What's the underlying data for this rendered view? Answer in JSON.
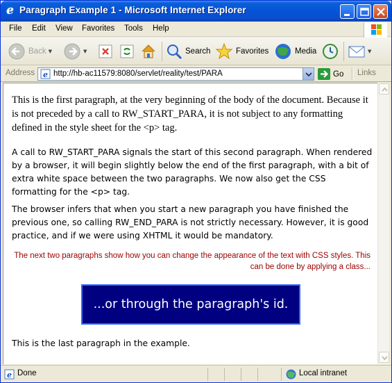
{
  "window": {
    "title": "Paragraph Example 1 - Microsoft Internet Explorer"
  },
  "menu": [
    "File",
    "Edit",
    "View",
    "Favorites",
    "Tools",
    "Help"
  ],
  "toolbar": {
    "back_label": "Back",
    "search_label": "Search",
    "favorites_label": "Favorites",
    "media_label": "Media"
  },
  "address": {
    "label": "Address",
    "url": "http://hb-ac11579:8080/servlet/reality/test/PARA",
    "go_label": "Go",
    "links_label": "Links"
  },
  "content": {
    "para1": "This is the first paragraph, at the very beginning of the body of the document. Because it is not preceded by a call to RW_START_PARA, it is not subject to any formatting defined in the style sheet for the <p> tag.",
    "para2": "A call to RW_START_PARA signals the start of this second paragraph. When rendered by a browser, it will begin slightly below the end of the first paragraph, with a bit of extra white space between the two paragraphs. We now also get the CSS formatting for the <p> tag.",
    "para3": "The browser infers that when you start a new paragraph you have finished the previous one, so calling RW_END_PARA is not strictly necessary. However, it is good practice, and if we were using XHTML it would be mandatory.",
    "para4": "The next two paragraphs show how you can change the appearance of the text with CSS styles. This can be done by applying a class...",
    "para5": "...or through the paragraph's id.",
    "para6": "This is the last paragraph in the example."
  },
  "status": {
    "text": "Done",
    "zone": "Local intranet"
  },
  "colors": {
    "title_bar": "#0553d5",
    "class_para_text": "#990000",
    "id_para_background": "#000080",
    "id_para_border": "#3366ff"
  },
  "icons": [
    "ie-icon",
    "minimize-icon",
    "maximize-icon",
    "close-icon",
    "windows-logo-icon",
    "back-icon",
    "forward-icon",
    "stop-icon",
    "refresh-icon",
    "home-icon",
    "search-icon",
    "favorites-icon",
    "media-icon",
    "history-icon",
    "mail-icon",
    "page-icon",
    "go-arrow-icon",
    "intranet-icon"
  ]
}
